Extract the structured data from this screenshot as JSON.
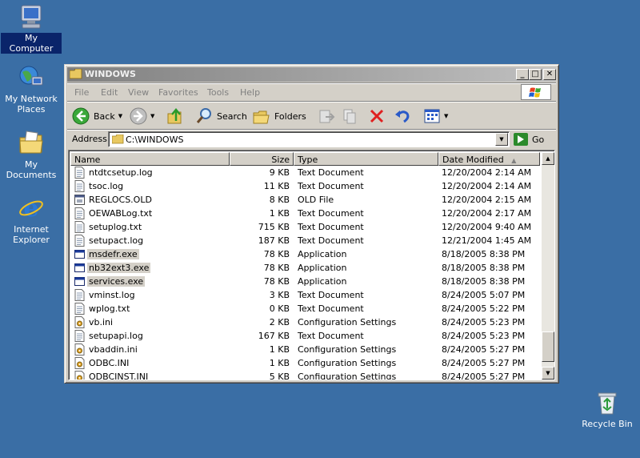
{
  "desktop": {
    "icons": [
      {
        "label": "My Computer",
        "name": "my-computer"
      },
      {
        "label": "My Network Places",
        "name": "my-network-places"
      },
      {
        "label": "My Documents",
        "name": "my-documents"
      },
      {
        "label": "Internet Explorer",
        "name": "internet-explorer"
      },
      {
        "label": "Recycle Bin",
        "name": "recycle-bin"
      }
    ]
  },
  "window": {
    "title": "WINDOWS",
    "controls": {
      "minimize": "_",
      "maximize": "□",
      "close": "✕"
    }
  },
  "menu": [
    "File",
    "Edit",
    "View",
    "Favorites",
    "Tools",
    "Help"
  ],
  "toolbar": {
    "back": "Back",
    "search": "Search",
    "folders": "Folders"
  },
  "address": {
    "label": "Address",
    "value": "C:\\WINDOWS",
    "go": "Go"
  },
  "columns": {
    "name": "Name",
    "size": "Size",
    "type": "Type",
    "date": "Date Modified"
  },
  "files": [
    {
      "name": "ntdtcsetup.log",
      "size": "9 KB",
      "type": "Text Document",
      "date": "12/20/2004 2:14 AM",
      "icon": "text-file-icon",
      "selected": false
    },
    {
      "name": "tsoc.log",
      "size": "11 KB",
      "type": "Text Document",
      "date": "12/20/2004 2:14 AM",
      "icon": "text-file-icon",
      "selected": false
    },
    {
      "name": "REGLOCS.OLD",
      "size": "8 KB",
      "type": "OLD File",
      "date": "12/20/2004 2:15 AM",
      "icon": "generic-file-icon",
      "selected": false
    },
    {
      "name": "OEWABLog.txt",
      "size": "1 KB",
      "type": "Text Document",
      "date": "12/20/2004 2:17 AM",
      "icon": "text-file-icon",
      "selected": false
    },
    {
      "name": "setuplog.txt",
      "size": "715 KB",
      "type": "Text Document",
      "date": "12/20/2004 9:40 AM",
      "icon": "text-file-icon",
      "selected": false
    },
    {
      "name": "setupact.log",
      "size": "187 KB",
      "type": "Text Document",
      "date": "12/21/2004 1:45 AM",
      "icon": "text-file-icon",
      "selected": false
    },
    {
      "name": "msdefr.exe",
      "size": "78 KB",
      "type": "Application",
      "date": "8/18/2005 8:38 PM",
      "icon": "application-icon",
      "selected": true
    },
    {
      "name": "nb32ext3.exe",
      "size": "78 KB",
      "type": "Application",
      "date": "8/18/2005 8:38 PM",
      "icon": "application-icon",
      "selected": true
    },
    {
      "name": "services.exe",
      "size": "78 KB",
      "type": "Application",
      "date": "8/18/2005 8:38 PM",
      "icon": "application-icon",
      "selected": true
    },
    {
      "name": "vminst.log",
      "size": "3 KB",
      "type": "Text Document",
      "date": "8/24/2005 5:07 PM",
      "icon": "text-file-icon",
      "selected": false
    },
    {
      "name": "wplog.txt",
      "size": "0 KB",
      "type": "Text Document",
      "date": "8/24/2005 5:22 PM",
      "icon": "text-file-icon",
      "selected": false
    },
    {
      "name": "vb.ini",
      "size": "2 KB",
      "type": "Configuration Settings",
      "date": "8/24/2005 5:23 PM",
      "icon": "config-file-icon",
      "selected": false
    },
    {
      "name": "setupapi.log",
      "size": "167 KB",
      "type": "Text Document",
      "date": "8/24/2005 5:23 PM",
      "icon": "text-file-icon",
      "selected": false
    },
    {
      "name": "vbaddin.ini",
      "size": "1 KB",
      "type": "Configuration Settings",
      "date": "8/24/2005 5:27 PM",
      "icon": "config-file-icon",
      "selected": false
    },
    {
      "name": "ODBC.INI",
      "size": "1 KB",
      "type": "Configuration Settings",
      "date": "8/24/2005 5:27 PM",
      "icon": "config-file-icon",
      "selected": false
    },
    {
      "name": "ODBCINST.INI",
      "size": "5 KB",
      "type": "Configuration Settings",
      "date": "8/24/2005 5:27 PM",
      "icon": "config-file-icon",
      "selected": false
    }
  ],
  "colors": {
    "desktop": "#3a6ea5",
    "window_face": "#d4d0c8",
    "inactive_title_start": "#808080",
    "inactive_title_end": "#c0c0c0",
    "selection_inactive": "#d4d0c8",
    "desktop_label_selected": "#0a246a"
  }
}
